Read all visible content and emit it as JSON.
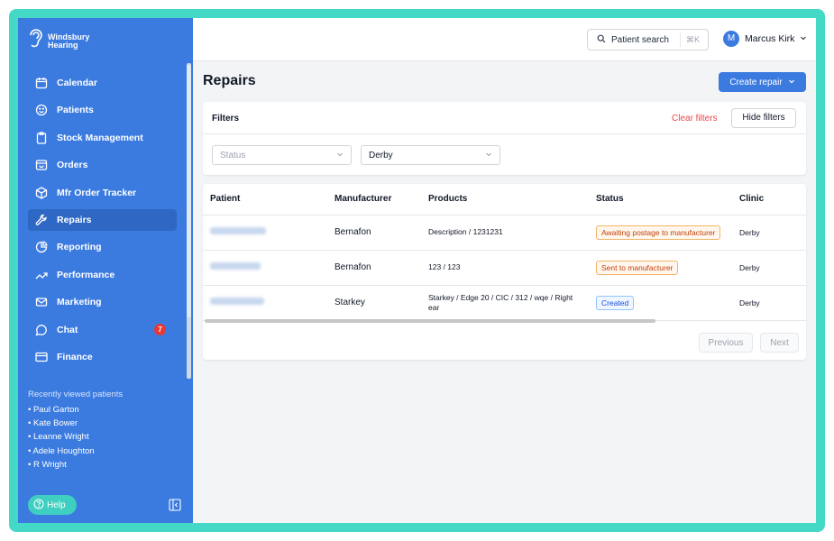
{
  "brand": {
    "line1": "Windsbury",
    "line2": "Hearing"
  },
  "sidebar": {
    "items": [
      {
        "label": "Calendar",
        "icon": "calendar-icon"
      },
      {
        "label": "Patients",
        "icon": "smile-icon"
      },
      {
        "label": "Stock Management",
        "icon": "clipboard-icon"
      },
      {
        "label": "Orders",
        "icon": "box-icon"
      },
      {
        "label": "Mfr Order Tracker",
        "icon": "package-icon"
      },
      {
        "label": "Repairs",
        "icon": "wrench-icon",
        "active": true
      },
      {
        "label": "Reporting",
        "icon": "pie-chart-icon"
      },
      {
        "label": "Performance",
        "icon": "trending-up-icon"
      },
      {
        "label": "Marketing",
        "icon": "mail-icon"
      },
      {
        "label": "Chat",
        "icon": "chat-icon",
        "badge": "7"
      },
      {
        "label": "Finance",
        "icon": "credit-card-icon"
      }
    ],
    "recent_title": "Recently viewed patients",
    "recent": [
      "• Paul Garton",
      "• Kate Bower",
      "• Leanne Wright",
      "• Adele Houghton",
      "• R Wright"
    ],
    "help_label": "Help"
  },
  "topbar": {
    "search_label": "Patient search",
    "search_shortcut": "⌘K",
    "user_initial": "M",
    "user_name": "Marcus Kirk"
  },
  "page": {
    "title": "Repairs",
    "create_label": "Create repair"
  },
  "filters": {
    "title": "Filters",
    "clear_label": "Clear filters",
    "hide_label": "Hide filters",
    "status_placeholder": "Status",
    "clinic_value": "Derby"
  },
  "table": {
    "headers": [
      "Patient",
      "Manufacturer",
      "Products",
      "Status",
      "Clinic"
    ],
    "rows": [
      {
        "manufacturer": "Bernafon",
        "products": "Description / 1231231",
        "status": "Awaiting postage to manufacturer",
        "status_color": "orange",
        "clinic": "Derby"
      },
      {
        "manufacturer": "Bernafon",
        "products": "123 / 123",
        "status": "Sent to manufacturer",
        "status_color": "orange",
        "clinic": "Derby"
      },
      {
        "manufacturer": "Starkey",
        "products": "Starkey / Edge 20 / CIC / 312 / wqe / Right ear",
        "status": "Created",
        "status_color": "blue",
        "clinic": "Derby"
      }
    ],
    "previous_label": "Previous",
    "next_label": "Next"
  },
  "colors": {
    "accent": "#3b7be0",
    "frame": "#44d9c6",
    "danger": "#ef4444"
  }
}
